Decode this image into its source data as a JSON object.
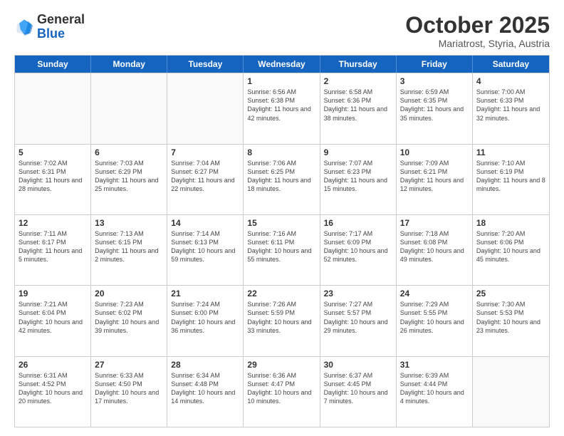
{
  "header": {
    "logo_general": "General",
    "logo_blue": "Blue",
    "month_title": "October 2025",
    "subtitle": "Mariatrost, Styria, Austria"
  },
  "days_of_week": [
    "Sunday",
    "Monday",
    "Tuesday",
    "Wednesday",
    "Thursday",
    "Friday",
    "Saturday"
  ],
  "weeks": [
    [
      {
        "day": "",
        "info": ""
      },
      {
        "day": "",
        "info": ""
      },
      {
        "day": "",
        "info": ""
      },
      {
        "day": "1",
        "info": "Sunrise: 6:56 AM\nSunset: 6:38 PM\nDaylight: 11 hours\nand 42 minutes."
      },
      {
        "day": "2",
        "info": "Sunrise: 6:58 AM\nSunset: 6:36 PM\nDaylight: 11 hours\nand 38 minutes."
      },
      {
        "day": "3",
        "info": "Sunrise: 6:59 AM\nSunset: 6:35 PM\nDaylight: 11 hours\nand 35 minutes."
      },
      {
        "day": "4",
        "info": "Sunrise: 7:00 AM\nSunset: 6:33 PM\nDaylight: 11 hours\nand 32 minutes."
      }
    ],
    [
      {
        "day": "5",
        "info": "Sunrise: 7:02 AM\nSunset: 6:31 PM\nDaylight: 11 hours\nand 28 minutes."
      },
      {
        "day": "6",
        "info": "Sunrise: 7:03 AM\nSunset: 6:29 PM\nDaylight: 11 hours\nand 25 minutes."
      },
      {
        "day": "7",
        "info": "Sunrise: 7:04 AM\nSunset: 6:27 PM\nDaylight: 11 hours\nand 22 minutes."
      },
      {
        "day": "8",
        "info": "Sunrise: 7:06 AM\nSunset: 6:25 PM\nDaylight: 11 hours\nand 18 minutes."
      },
      {
        "day": "9",
        "info": "Sunrise: 7:07 AM\nSunset: 6:23 PM\nDaylight: 11 hours\nand 15 minutes."
      },
      {
        "day": "10",
        "info": "Sunrise: 7:09 AM\nSunset: 6:21 PM\nDaylight: 11 hours\nand 12 minutes."
      },
      {
        "day": "11",
        "info": "Sunrise: 7:10 AM\nSunset: 6:19 PM\nDaylight: 11 hours\nand 8 minutes."
      }
    ],
    [
      {
        "day": "12",
        "info": "Sunrise: 7:11 AM\nSunset: 6:17 PM\nDaylight: 11 hours\nand 5 minutes."
      },
      {
        "day": "13",
        "info": "Sunrise: 7:13 AM\nSunset: 6:15 PM\nDaylight: 11 hours\nand 2 minutes."
      },
      {
        "day": "14",
        "info": "Sunrise: 7:14 AM\nSunset: 6:13 PM\nDaylight: 10 hours\nand 59 minutes."
      },
      {
        "day": "15",
        "info": "Sunrise: 7:16 AM\nSunset: 6:11 PM\nDaylight: 10 hours\nand 55 minutes."
      },
      {
        "day": "16",
        "info": "Sunrise: 7:17 AM\nSunset: 6:09 PM\nDaylight: 10 hours\nand 52 minutes."
      },
      {
        "day": "17",
        "info": "Sunrise: 7:18 AM\nSunset: 6:08 PM\nDaylight: 10 hours\nand 49 minutes."
      },
      {
        "day": "18",
        "info": "Sunrise: 7:20 AM\nSunset: 6:06 PM\nDaylight: 10 hours\nand 45 minutes."
      }
    ],
    [
      {
        "day": "19",
        "info": "Sunrise: 7:21 AM\nSunset: 6:04 PM\nDaylight: 10 hours\nand 42 minutes."
      },
      {
        "day": "20",
        "info": "Sunrise: 7:23 AM\nSunset: 6:02 PM\nDaylight: 10 hours\nand 39 minutes."
      },
      {
        "day": "21",
        "info": "Sunrise: 7:24 AM\nSunset: 6:00 PM\nDaylight: 10 hours\nand 36 minutes."
      },
      {
        "day": "22",
        "info": "Sunrise: 7:26 AM\nSunset: 5:59 PM\nDaylight: 10 hours\nand 33 minutes."
      },
      {
        "day": "23",
        "info": "Sunrise: 7:27 AM\nSunset: 5:57 PM\nDaylight: 10 hours\nand 29 minutes."
      },
      {
        "day": "24",
        "info": "Sunrise: 7:29 AM\nSunset: 5:55 PM\nDaylight: 10 hours\nand 26 minutes."
      },
      {
        "day": "25",
        "info": "Sunrise: 7:30 AM\nSunset: 5:53 PM\nDaylight: 10 hours\nand 23 minutes."
      }
    ],
    [
      {
        "day": "26",
        "info": "Sunrise: 6:31 AM\nSunset: 4:52 PM\nDaylight: 10 hours\nand 20 minutes."
      },
      {
        "day": "27",
        "info": "Sunrise: 6:33 AM\nSunset: 4:50 PM\nDaylight: 10 hours\nand 17 minutes."
      },
      {
        "day": "28",
        "info": "Sunrise: 6:34 AM\nSunset: 4:48 PM\nDaylight: 10 hours\nand 14 minutes."
      },
      {
        "day": "29",
        "info": "Sunrise: 6:36 AM\nSunset: 4:47 PM\nDaylight: 10 hours\nand 10 minutes."
      },
      {
        "day": "30",
        "info": "Sunrise: 6:37 AM\nSunset: 4:45 PM\nDaylight: 10 hours\nand 7 minutes."
      },
      {
        "day": "31",
        "info": "Sunrise: 6:39 AM\nSunset: 4:44 PM\nDaylight: 10 hours\nand 4 minutes."
      },
      {
        "day": "",
        "info": ""
      }
    ]
  ]
}
